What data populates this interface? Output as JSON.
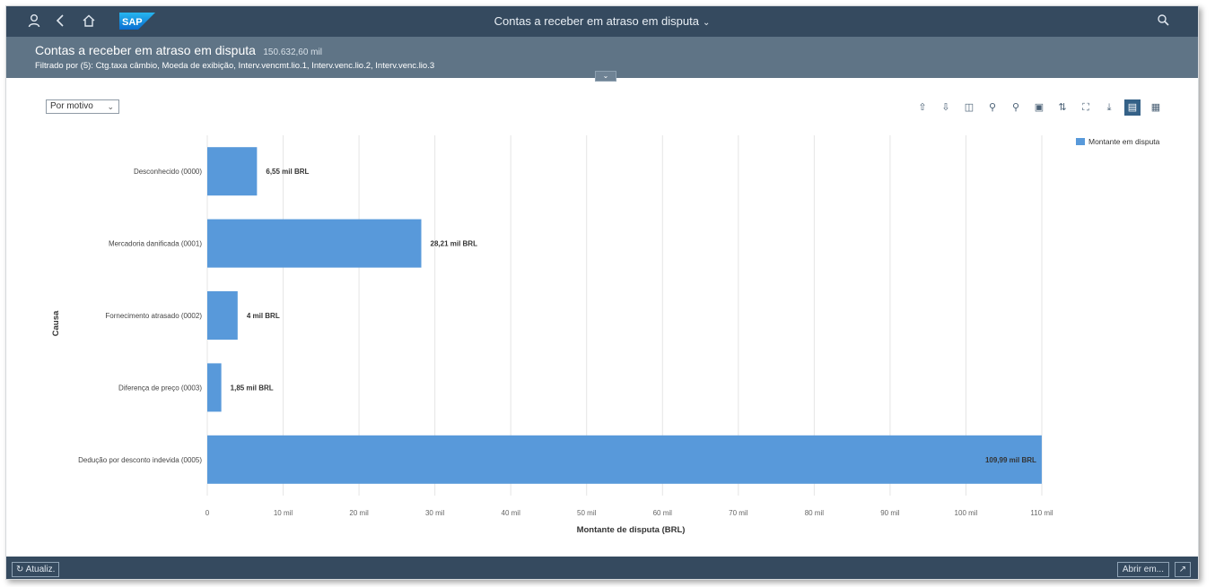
{
  "shell": {
    "title": "Contas a receber em atraso em disputa",
    "logo": "SAP",
    "icons": [
      "user-icon",
      "back-icon",
      "home-icon",
      "search-icon"
    ]
  },
  "header": {
    "title": "Contas a receber em atraso em disputa",
    "amount": "150.632,60 mil",
    "filter": "Filtrado por (5): Ctg.taxa câmbio, Moeda de exibição, Interv.vencmt.lio.1, Interv.venc.lio.2, Interv.venc.lio.3"
  },
  "toolbar": {
    "select_value": "Por motivo",
    "buttons": [
      "drill-up-icon",
      "drill-down-icon",
      "settings-columns-icon",
      "zoom-in-icon",
      "zoom-out-icon",
      "legend-icon",
      "sort-icon",
      "fullscreen-icon",
      "download-icon",
      "chart-view-icon",
      "table-view-icon"
    ]
  },
  "legend": {
    "label": "Montante em disputa",
    "color": "#5899da"
  },
  "chart_data": {
    "type": "bar",
    "orientation": "horizontal",
    "categories": [
      "Desconhecido (0000)",
      "Mercadoria danificada (0001)",
      "Fornecimento atrasado (0002)",
      "Diferença de preço (0003)",
      "Dedução por desconto indevida (0005)"
    ],
    "values": [
      6.55,
      28.21,
      4,
      1.85,
      109.99
    ],
    "data_labels": [
      "6,55 mil BRL",
      "28,21 mil BRL",
      "4 mil BRL",
      "1,85 mil BRL",
      "109,99 mil BRL"
    ],
    "xlabel": "Montante de disputa (BRL)",
    "ylabel": "Causa",
    "xlim": [
      0,
      110
    ],
    "xticks": [
      0,
      10,
      20,
      30,
      40,
      50,
      60,
      70,
      80,
      90,
      100,
      110
    ],
    "xtick_labels": [
      "0",
      "10 mil",
      "20 mil",
      "30 mil",
      "40 mil",
      "50 mil",
      "60 mil",
      "70 mil",
      "80 mil",
      "90 mil",
      "100 mil",
      "110 mil"
    ],
    "grid": true,
    "legend_position": "top-right",
    "color": "#5899da"
  },
  "footer": {
    "update_label": "Atualiz.",
    "open_label": "Abrir em..."
  }
}
